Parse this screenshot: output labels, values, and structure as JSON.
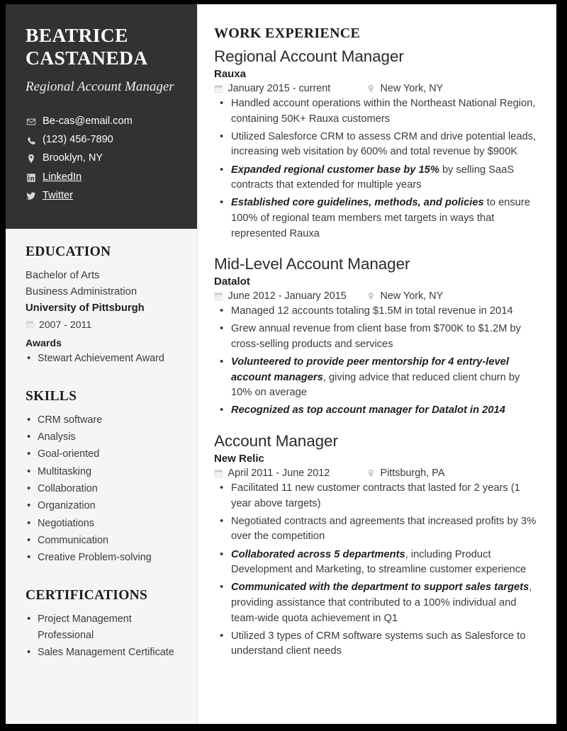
{
  "colors": {
    "page_border": "#000000",
    "sidebar_header_bg": "#323232",
    "sidebar_bg": "#f5f5f5",
    "main_bg": "#ffffff",
    "heading_text": "#1c1c1c",
    "body_text": "#3b3b3b",
    "icon_muted": "#cccccc"
  },
  "sidebar": {
    "name": "BEATRICE CASTANEDA",
    "name_line1": "BEATRICE",
    "name_line2": "CASTANEDA",
    "headline": "Regional Account Manager",
    "contacts": [
      {
        "icon": "envelope-icon",
        "text": "Be-cas@email.com",
        "link": false
      },
      {
        "icon": "phone-icon",
        "text": "(123) 456-7890",
        "link": false
      },
      {
        "icon": "map-pin-icon",
        "text": "Brooklyn, NY",
        "link": false
      },
      {
        "icon": "linkedin-icon",
        "text": "LinkedIn",
        "link": true
      },
      {
        "icon": "twitter-icon",
        "text": "Twitter",
        "link": true
      }
    ],
    "education": {
      "heading": "EDUCATION",
      "degree": "Bachelor of Arts",
      "field": "Business Administration",
      "school": "University of Pittsburgh",
      "dates": "2007 - 2011",
      "date_icon": "calendar-icon",
      "awards_label": "Awards",
      "awards": [
        "Stewart Achievement Award"
      ]
    },
    "skills": {
      "heading": "SKILLS",
      "items": [
        "CRM software",
        "Analysis",
        "Goal-oriented",
        "Multitasking",
        "Collaboration",
        "Organization",
        "Negotiations",
        "Communication",
        "Creative Problem-solving"
      ]
    },
    "certifications": {
      "heading": "CERTIFICATIONS",
      "items": [
        "Project Management Professional",
        "Sales Management Certificate"
      ]
    }
  },
  "main": {
    "heading": "WORK EXPERIENCE",
    "jobs": [
      {
        "title": "Regional Account Manager",
        "company": "Rauxa",
        "dates": "January 2015 - current",
        "location": "New York, NY",
        "date_icon": "calendar-icon",
        "location_icon": "map-pin-icon",
        "bullets": [
          {
            "lead": "",
            "rest": "Handled account operations within the Northeast National Region, containing 50K+ Rauxa customers"
          },
          {
            "lead": "",
            "rest": "Utilized Salesforce CRM to assess CRM and drive potential leads, increasing web visitation by 600% and total revenue by $900K"
          },
          {
            "lead": "Expanded regional customer base by 15%",
            "rest": " by selling SaaS contracts that extended for multiple years"
          },
          {
            "lead": "Established core guidelines, methods, and policies",
            "rest": " to ensure 100% of regional team members met targets in ways that represented Rauxa"
          }
        ]
      },
      {
        "title": "Mid-Level Account Manager",
        "company": "Datalot",
        "dates": "June 2012 - January 2015",
        "location": "New York, NY",
        "date_icon": "calendar-icon",
        "location_icon": "map-pin-icon",
        "bullets": [
          {
            "lead": "",
            "rest": "Managed 12 accounts totaling $1.5M in total revenue in 2014"
          },
          {
            "lead": "",
            "rest": "Grew annual revenue from client base from $700K to $1.2M by cross-selling products and services"
          },
          {
            "lead": "Volunteered to provide peer mentorship for 4 entry-level account managers",
            "rest": ", giving advice that reduced client churn by 10% on average"
          },
          {
            "lead": "Recognized as top account manager for Datalot in 2014",
            "rest": ""
          }
        ]
      },
      {
        "title": "Account Manager",
        "company": "New Relic",
        "dates": "April 2011 - June 2012",
        "location": "Pittsburgh, PA",
        "date_icon": "calendar-icon",
        "location_icon": "map-pin-icon",
        "bullets": [
          {
            "lead": "",
            "rest": "Facilitated 11 new customer contracts that lasted for 2 years (1 year above targets)"
          },
          {
            "lead": "",
            "rest": "Negotiated contracts and agreements that increased profits by 3% over the competition"
          },
          {
            "lead": "Collaborated across 5 departments",
            "rest": ", including Product Development and Marketing, to streamline customer experience"
          },
          {
            "lead": "Communicated with the department to support sales targets",
            "rest": ", providing assistance that contributed to a 100% individual and team-wide quota achievement in Q1"
          },
          {
            "lead": "",
            "rest": "Utilized 3 types of CRM software systems such as Salesforce to understand client needs"
          }
        ]
      }
    ]
  }
}
